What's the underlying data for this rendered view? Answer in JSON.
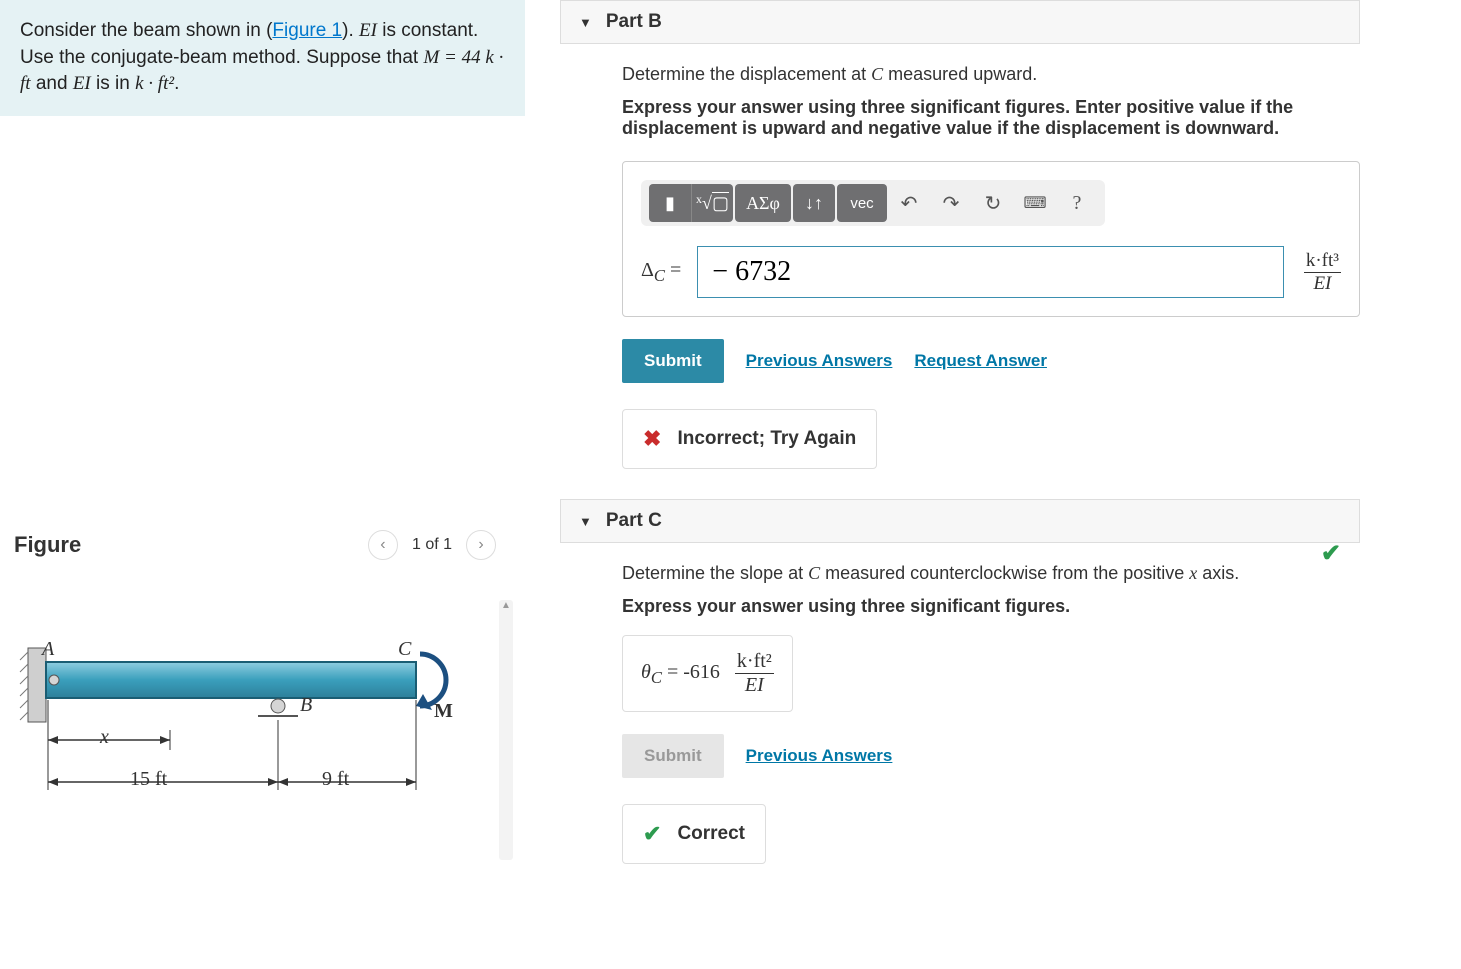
{
  "problem": {
    "pre": "Consider the beam shown in (",
    "figure_link": "Figure 1",
    "post1": "). ",
    "ei": "EI",
    "post2": " is constant. Use the conjugate-beam method. Suppose that ",
    "m_eq": "M = 44 k · ft",
    "post3": " and ",
    "ei2": "EI",
    "post4": " is in ",
    "unit": "k · ft²",
    "post5": "."
  },
  "figure": {
    "title": "Figure",
    "count": "1 of 1",
    "labels": {
      "A": "A",
      "B": "B",
      "C": "C",
      "M": "M",
      "x": "x",
      "d1": "15 ft",
      "d2": "9 ft"
    }
  },
  "partB": {
    "title": "Part B",
    "question_pre": "Determine the displacement at ",
    "question_var": "C",
    "question_post": " measured upward.",
    "instruction": "Express your answer using three significant figures. Enter positive value if the displacement is upward and negative value if the displacement is downward.",
    "toolbar": {
      "template": "▮",
      "sqrt": "√",
      "greek": "ΑΣφ",
      "updown": "↓↑",
      "vec": "vec",
      "undo": "↶",
      "redo": "↷",
      "reset": "↻",
      "keyboard": "⌨",
      "help": "?"
    },
    "var_html": "Δ<sub><i>C</i></sub> =",
    "input_value": "− 6732",
    "unit_html": "k·ft³",
    "unit_denom": "EI",
    "submit": "Submit",
    "prev": "Previous Answers",
    "request": "Request Answer",
    "feedback": "Incorrect; Try Again"
  },
  "partC": {
    "title": "Part C",
    "question_pre": "Determine the slope at ",
    "question_var": "C",
    "question_mid": " measured counterclockwise from the positive ",
    "question_var2": "x",
    "question_post": " axis.",
    "instruction": "Express your answer using three significant figures.",
    "var": "θ",
    "sub": "C",
    "eq": " = ",
    "value": "-616",
    "unit_top": "k·ft²",
    "unit_denom": "EI",
    "submit": "Submit",
    "prev": "Previous Answers",
    "feedback": "Correct"
  }
}
